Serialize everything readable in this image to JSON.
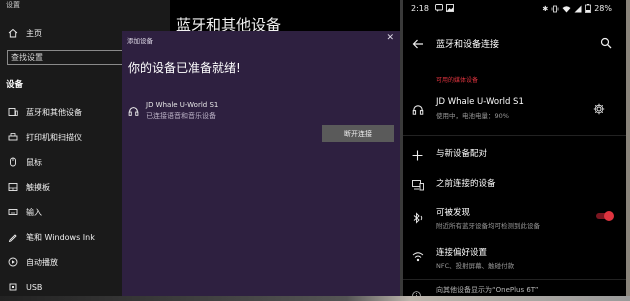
{
  "windows": {
    "window_title": "设置",
    "nav_home": "主页",
    "search_placeholder": "查找设置",
    "section_title": "设备",
    "nav_items": [
      {
        "label": "蓝牙和其他设备"
      },
      {
        "label": "打印机和扫描仪"
      },
      {
        "label": "鼠标"
      },
      {
        "label": "触摸板"
      },
      {
        "label": "输入"
      },
      {
        "label": "笔和 Windows Ink"
      },
      {
        "label": "自动播放"
      },
      {
        "label": "USB"
      }
    ],
    "main_title": "蓝牙和其他设备"
  },
  "dialog": {
    "caption": "添加设备",
    "close_glyph": "✕",
    "heading": "你的设备已准备就绪!",
    "device_name": "JD Whale U-World S1",
    "device_status": "已连接语音和音乐设备",
    "disconnect_label": "断开连接"
  },
  "phone": {
    "status": {
      "time": "2:18",
      "battery": "28%"
    },
    "app_title": "蓝牙和设备连接",
    "media_section": "可用的媒体设备",
    "device_name": "JD Whale U-World S1",
    "device_status": "使用中，电池电量：90%",
    "pair_new": "与新设备配对",
    "previous_devices": "之前连接的设备",
    "discoverable": {
      "title": "可被发现",
      "subtitle": "附近所有蓝牙设备均可检测到此设备",
      "enabled": true
    },
    "preferences": {
      "title": "连接偏好设置",
      "subtitle": "NFC、投射屏幕、触碰付款"
    },
    "footer": "向其他设备显示为“OnePlus 6T”",
    "accent_color": "#e0343f"
  }
}
